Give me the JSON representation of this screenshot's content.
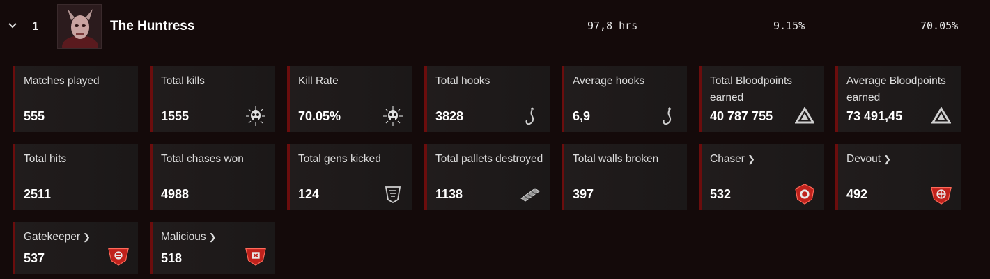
{
  "header": {
    "rank": "1",
    "name": "The Huntress",
    "hours": "97,8 hrs",
    "stat_pct_1": "9.15%",
    "stat_pct_2": "70.05%"
  },
  "cards": {
    "matches_played": {
      "label": "Matches played",
      "value": "555"
    },
    "total_kills": {
      "label": "Total kills",
      "value": "1555",
      "icon": "skull-icon"
    },
    "kill_rate": {
      "label": "Kill Rate",
      "value": "70.05%",
      "icon": "skull-icon"
    },
    "total_hooks": {
      "label": "Total hooks",
      "value": "3828",
      "icon": "hook-icon"
    },
    "average_hooks": {
      "label": "Average hooks",
      "value": "6,9",
      "icon": "hook-icon"
    },
    "total_bloodpoints": {
      "label": "Total Bloodpoints earned",
      "value": "40 787 755",
      "icon": "bloodpoints-icon"
    },
    "average_bloodpoints": {
      "label": "Average Bloodpoints earned",
      "value": "73 491,45",
      "icon": "bloodpoints-icon"
    },
    "total_hits": {
      "label": "Total hits",
      "value": "2511"
    },
    "total_chases_won": {
      "label": "Total chases won",
      "value": "4988"
    },
    "total_gens_kicked": {
      "label": "Total gens kicked",
      "value": "124",
      "icon": "generator-icon"
    },
    "total_pallets_destroyed": {
      "label": "Total pallets destroyed",
      "value": "1138",
      "icon": "pallet-icon"
    },
    "total_walls_broken": {
      "label": "Total walls broken",
      "value": "397"
    },
    "chaser": {
      "label": "Chaser",
      "value": "532",
      "icon": "emblem-icon"
    },
    "devout": {
      "label": "Devout",
      "value": "492",
      "icon": "emblem-icon"
    },
    "gatekeeper": {
      "label": "Gatekeeper",
      "value": "537",
      "icon": "emblem-icon"
    },
    "malicious": {
      "label": "Malicious",
      "value": "518",
      "icon": "emblem-icon"
    }
  },
  "colors": {
    "accent": "#6b0d0d",
    "background": "#140a0a",
    "card": "#1e1a1a",
    "emblem": "#c0221c"
  }
}
